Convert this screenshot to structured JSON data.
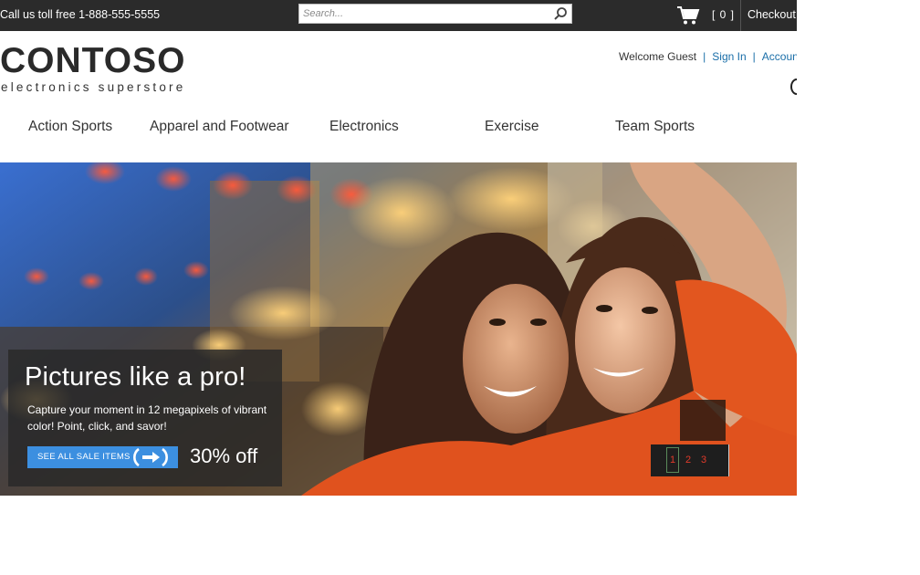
{
  "topbar": {
    "phone": "Call us toll free 1-888-555-5555",
    "search_placeholder": "Search...",
    "cart_count": "[ 0 ]",
    "checkout": "Checkout"
  },
  "header": {
    "logo_word": "CONTOSO",
    "logo_tagline": "electronics superstore",
    "welcome": "Welcome Guest",
    "sign_in": "Sign In",
    "account": "Account"
  },
  "nav": {
    "items": [
      {
        "label": "Action Sports"
      },
      {
        "label": "Apparel and Footwear"
      },
      {
        "label": "Electronics"
      },
      {
        "label": "Exercise"
      },
      {
        "label": "Team Sports"
      }
    ]
  },
  "hero": {
    "title": "Pictures like a pro!",
    "description": "Capture your moment in 12 megapixels of vibrant color!  Point, click, and savor!",
    "cta_label": "SEE ALL SALE ITEMS",
    "discount": "30% off",
    "pages": [
      "1",
      "2",
      "3"
    ],
    "active_page": "1"
  },
  "colors": {
    "topbar_bg": "#2b2b2b",
    "link": "#1a6ea8",
    "cta_bg": "#3c8fe0",
    "pager_text": "#e03a2a"
  },
  "icons": {
    "search": "search-icon",
    "cart": "cart-icon",
    "cta": "arrow-circle-icon"
  }
}
